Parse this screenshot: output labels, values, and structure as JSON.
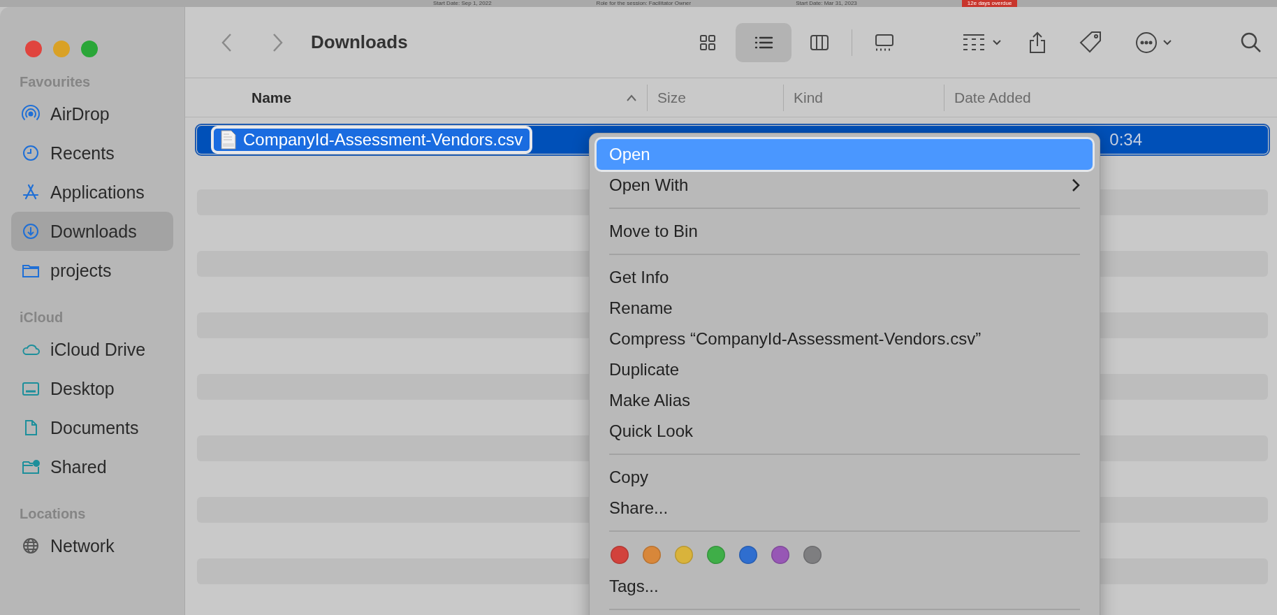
{
  "background_window": {
    "texts": [
      "Start Date: Sep 1, 2022",
      "Role for the session: Facilitator Owner",
      "Start Date: Mar 31, 2023"
    ],
    "badge": "12e days overdue"
  },
  "toolbar": {
    "title": "Downloads",
    "view_modes": [
      {
        "kind": "icons",
        "selected": false
      },
      {
        "kind": "list",
        "selected": true
      },
      {
        "kind": "columns",
        "selected": false
      },
      {
        "kind": "gallery",
        "selected": false
      }
    ]
  },
  "sidebar": {
    "sections": [
      {
        "title": "Favourites",
        "items": [
          {
            "label": "AirDrop",
            "kind": "airdrop",
            "selected": false
          },
          {
            "label": "Recents",
            "kind": "clock",
            "selected": false
          },
          {
            "label": "Applications",
            "kind": "apps",
            "selected": false
          },
          {
            "label": "Downloads",
            "kind": "download",
            "selected": true
          },
          {
            "label": "projects",
            "kind": "folder",
            "selected": false
          }
        ]
      },
      {
        "title": "iCloud",
        "items": [
          {
            "label": "iCloud Drive",
            "kind": "cloud",
            "selected": false
          },
          {
            "label": "Desktop",
            "kind": "desktop",
            "selected": false
          },
          {
            "label": "Documents",
            "kind": "document",
            "selected": false
          },
          {
            "label": "Shared",
            "kind": "shared",
            "selected": false
          }
        ]
      },
      {
        "title": "Locations",
        "items": [
          {
            "label": "Network",
            "kind": "globe",
            "selected": false
          }
        ]
      }
    ]
  },
  "table": {
    "columns": [
      {
        "label": "Name",
        "sorted": true
      },
      {
        "label": "Size",
        "sorted": false
      },
      {
        "label": "Kind",
        "sorted": false
      },
      {
        "label": "Date Added",
        "sorted": false
      }
    ],
    "rows": [
      {
        "name": "CompanyId-Assessment-Vendors.csv",
        "date_added": "0:34",
        "selected": true
      }
    ]
  },
  "context_menu": {
    "items": [
      {
        "kind": "item",
        "label": "Open",
        "selected": true
      },
      {
        "kind": "submenu",
        "label": "Open With",
        "selected": false
      },
      {
        "kind": "separator"
      },
      {
        "kind": "item",
        "label": "Move to Bin",
        "selected": false
      },
      {
        "kind": "separator"
      },
      {
        "kind": "item",
        "label": "Get Info",
        "selected": false
      },
      {
        "kind": "item",
        "label": "Rename",
        "selected": false
      },
      {
        "kind": "item",
        "label": "Compress “CompanyId-Assessment-Vendors.csv”",
        "selected": false
      },
      {
        "kind": "item",
        "label": "Duplicate",
        "selected": false
      },
      {
        "kind": "item",
        "label": "Make Alias",
        "selected": false
      },
      {
        "kind": "item",
        "label": "Quick Look",
        "selected": false
      },
      {
        "kind": "separator"
      },
      {
        "kind": "item",
        "label": "Copy",
        "selected": false
      },
      {
        "kind": "item",
        "label": "Share...",
        "selected": false
      },
      {
        "kind": "separator"
      },
      {
        "kind": "colors",
        "colors": [
          {
            "color": "#d2423c"
          },
          {
            "color": "#d8873a"
          },
          {
            "color": "#d9b33b"
          },
          {
            "color": "#3fae48"
          },
          {
            "color": "#2f6ecf"
          },
          {
            "color": "#9757b5"
          },
          {
            "color": "#7e7e80"
          }
        ]
      },
      {
        "kind": "item",
        "label": "Tags...",
        "selected": false
      },
      {
        "kind": "separator"
      }
    ]
  }
}
